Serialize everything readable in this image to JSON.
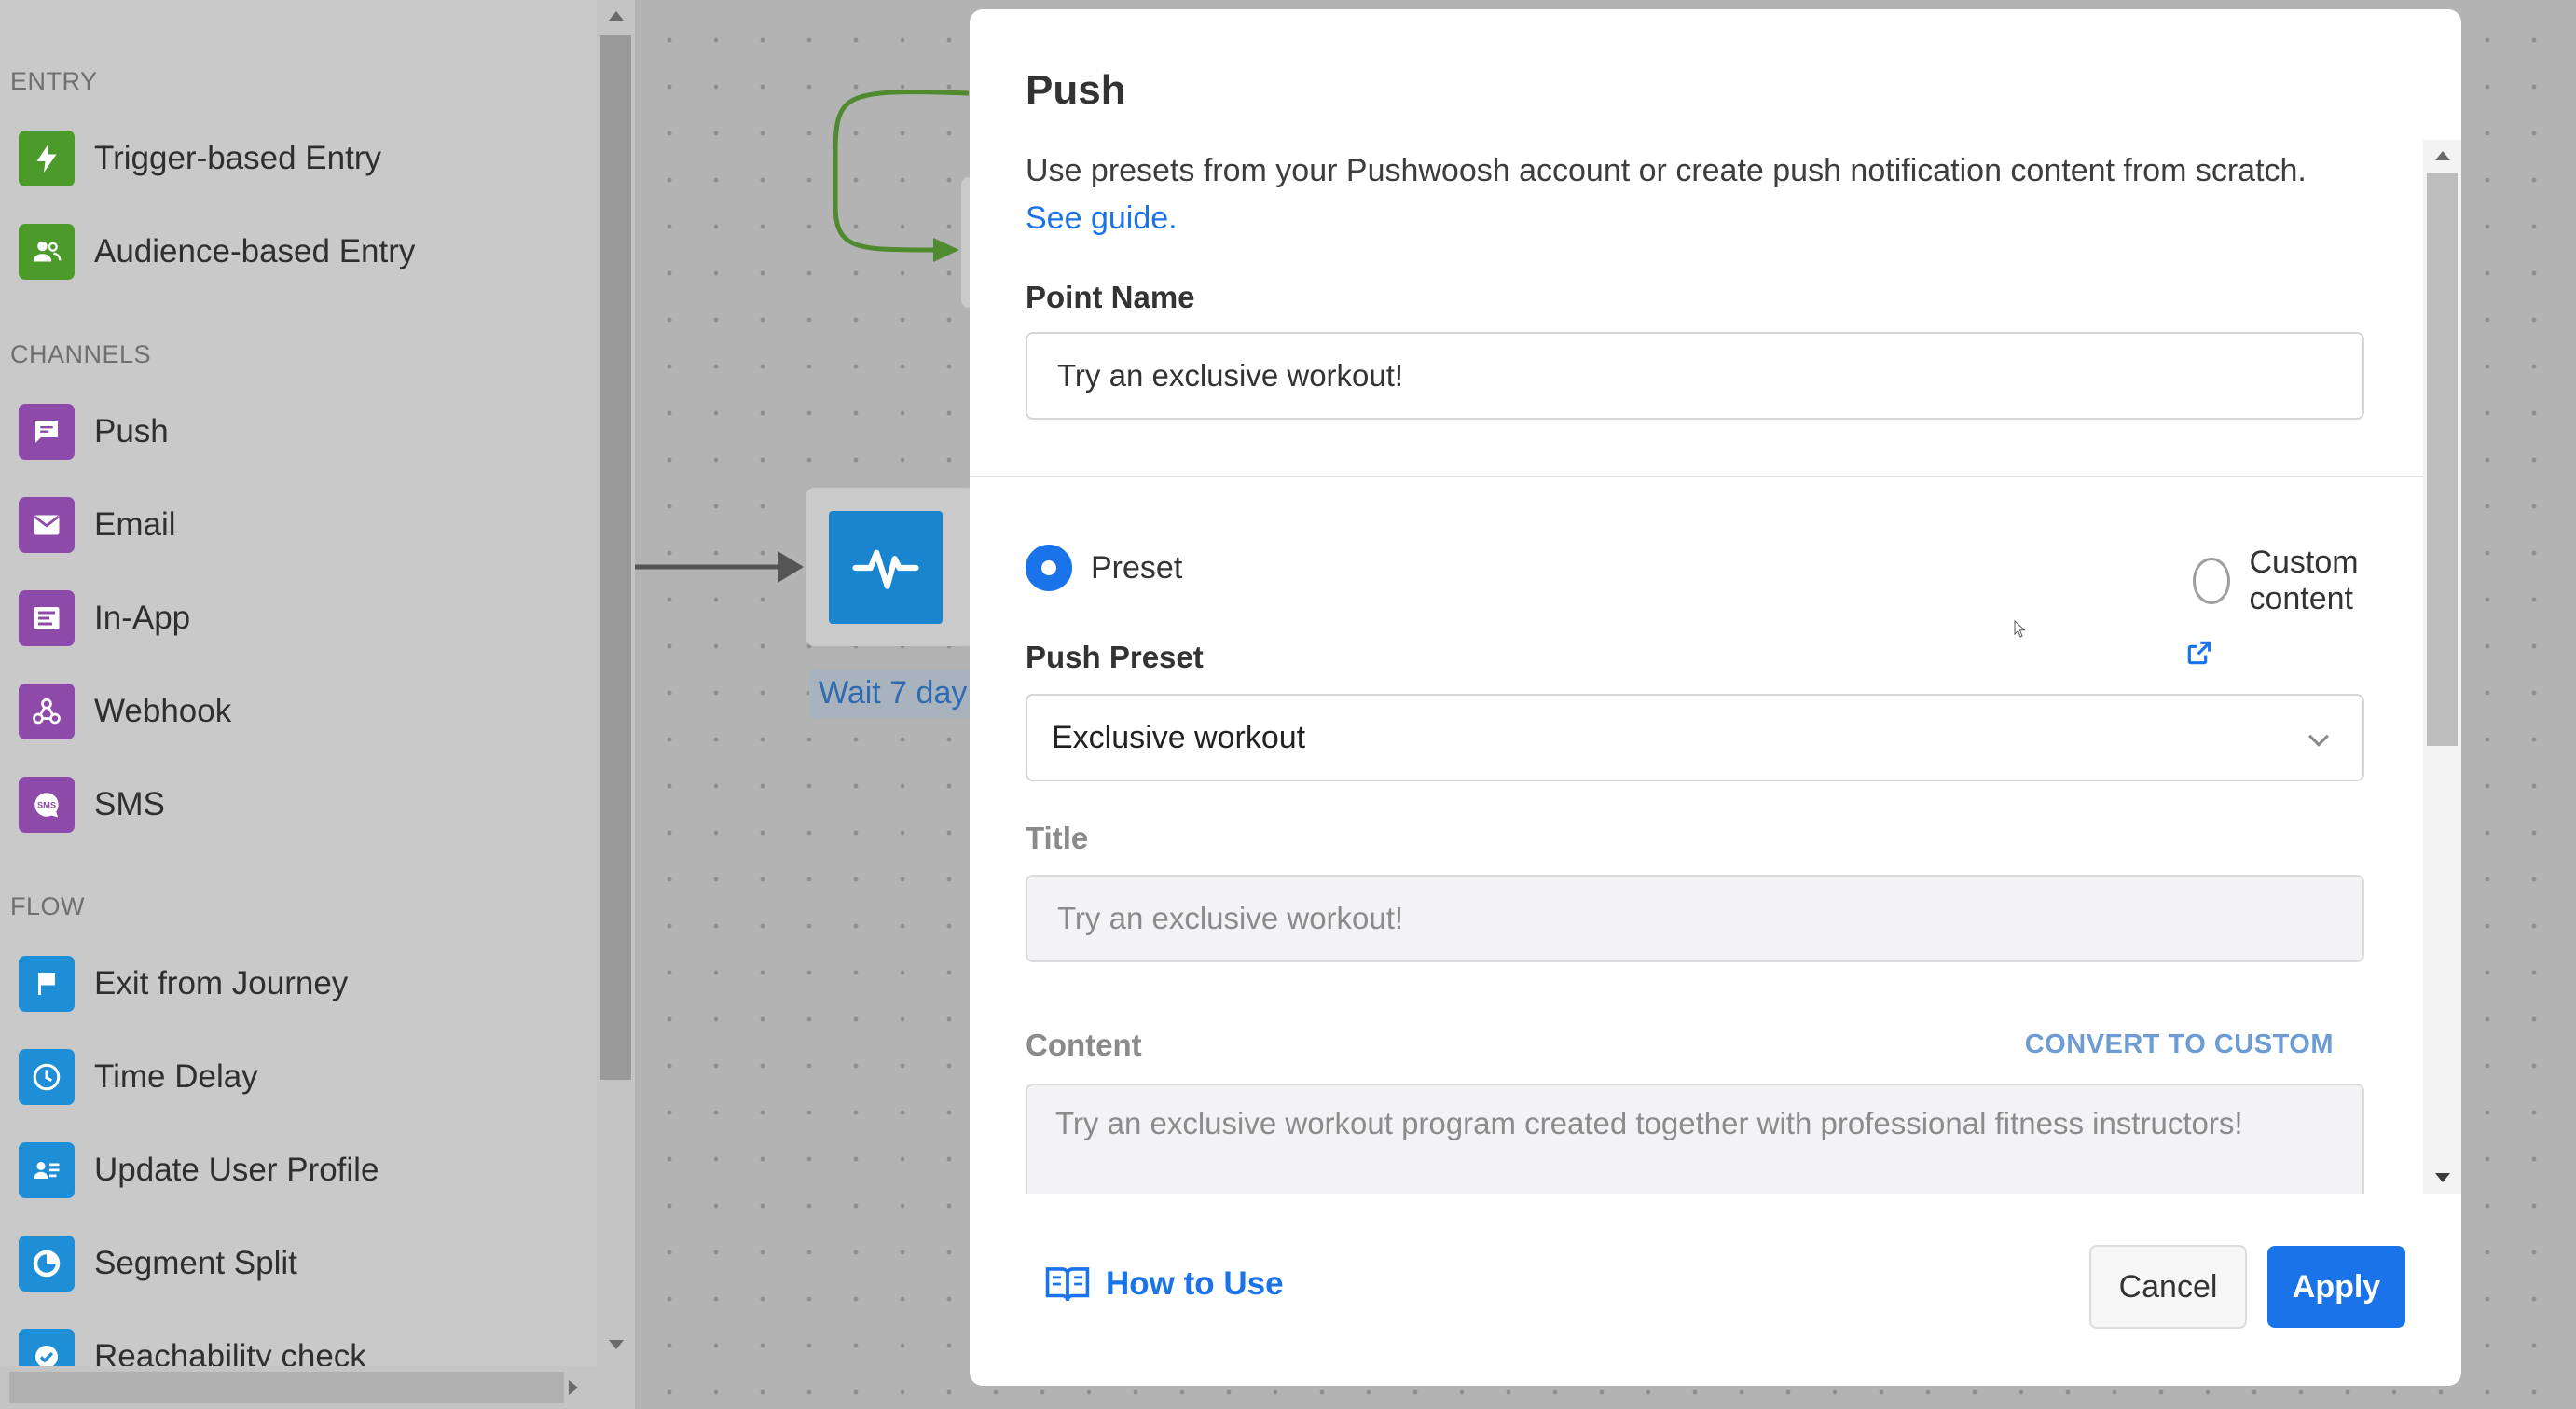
{
  "sidebar": {
    "sections": [
      {
        "label": "ENTRY"
      },
      {
        "label": "CHANNELS"
      },
      {
        "label": "FLOW"
      }
    ],
    "entry_items": [
      {
        "label": "Trigger-based Entry",
        "icon": "lightning-icon"
      },
      {
        "label": "Audience-based Entry",
        "icon": "users-icon"
      }
    ],
    "channel_items": [
      {
        "label": "Push",
        "icon": "push-message-icon"
      },
      {
        "label": "Email",
        "icon": "envelope-icon"
      },
      {
        "label": "In-App",
        "icon": "in-app-icon"
      },
      {
        "label": "Webhook",
        "icon": "webhook-icon"
      },
      {
        "label": "SMS",
        "icon": "sms-icon",
        "icon_text": "SMS"
      }
    ],
    "flow_items": [
      {
        "label": "Exit from Journey",
        "icon": "flag-icon"
      },
      {
        "label": "Time Delay",
        "icon": "clock-icon"
      },
      {
        "label": "Update User Profile",
        "icon": "user-profile-icon"
      },
      {
        "label": "Segment Split",
        "icon": "segment-split-icon"
      },
      {
        "label": "Reachability check",
        "icon": "check-badge-icon"
      }
    ]
  },
  "canvas": {
    "node_label": "Wait 7 day"
  },
  "modal": {
    "title": "Push",
    "description": "Use presets from your Pushwoosh account or create push notification content from scratch.",
    "see_guide": "See guide.",
    "point_name": {
      "label": "Point Name",
      "value": "Try an exclusive workout!"
    },
    "content_mode": {
      "options": [
        "Preset",
        "Custom content"
      ],
      "selected": "Preset"
    },
    "push_preset": {
      "label": "Push Preset",
      "selected": "Exclusive workout"
    },
    "title_field": {
      "label": "Title",
      "value": "Try an exclusive workout!"
    },
    "content_field": {
      "label": "Content",
      "convert_action": "CONVERT TO CUSTOM",
      "value": "Try an exclusive workout program created together with professional fitness instructors!"
    },
    "footer": {
      "how_to_use": "How to Use",
      "cancel": "Cancel",
      "apply": "Apply"
    }
  },
  "colors": {
    "accent": "#1a73e8",
    "entry_green": "#4c9a2a",
    "channel_purple": "#8e4aa8",
    "flow_blue": "#1e8fd6"
  }
}
